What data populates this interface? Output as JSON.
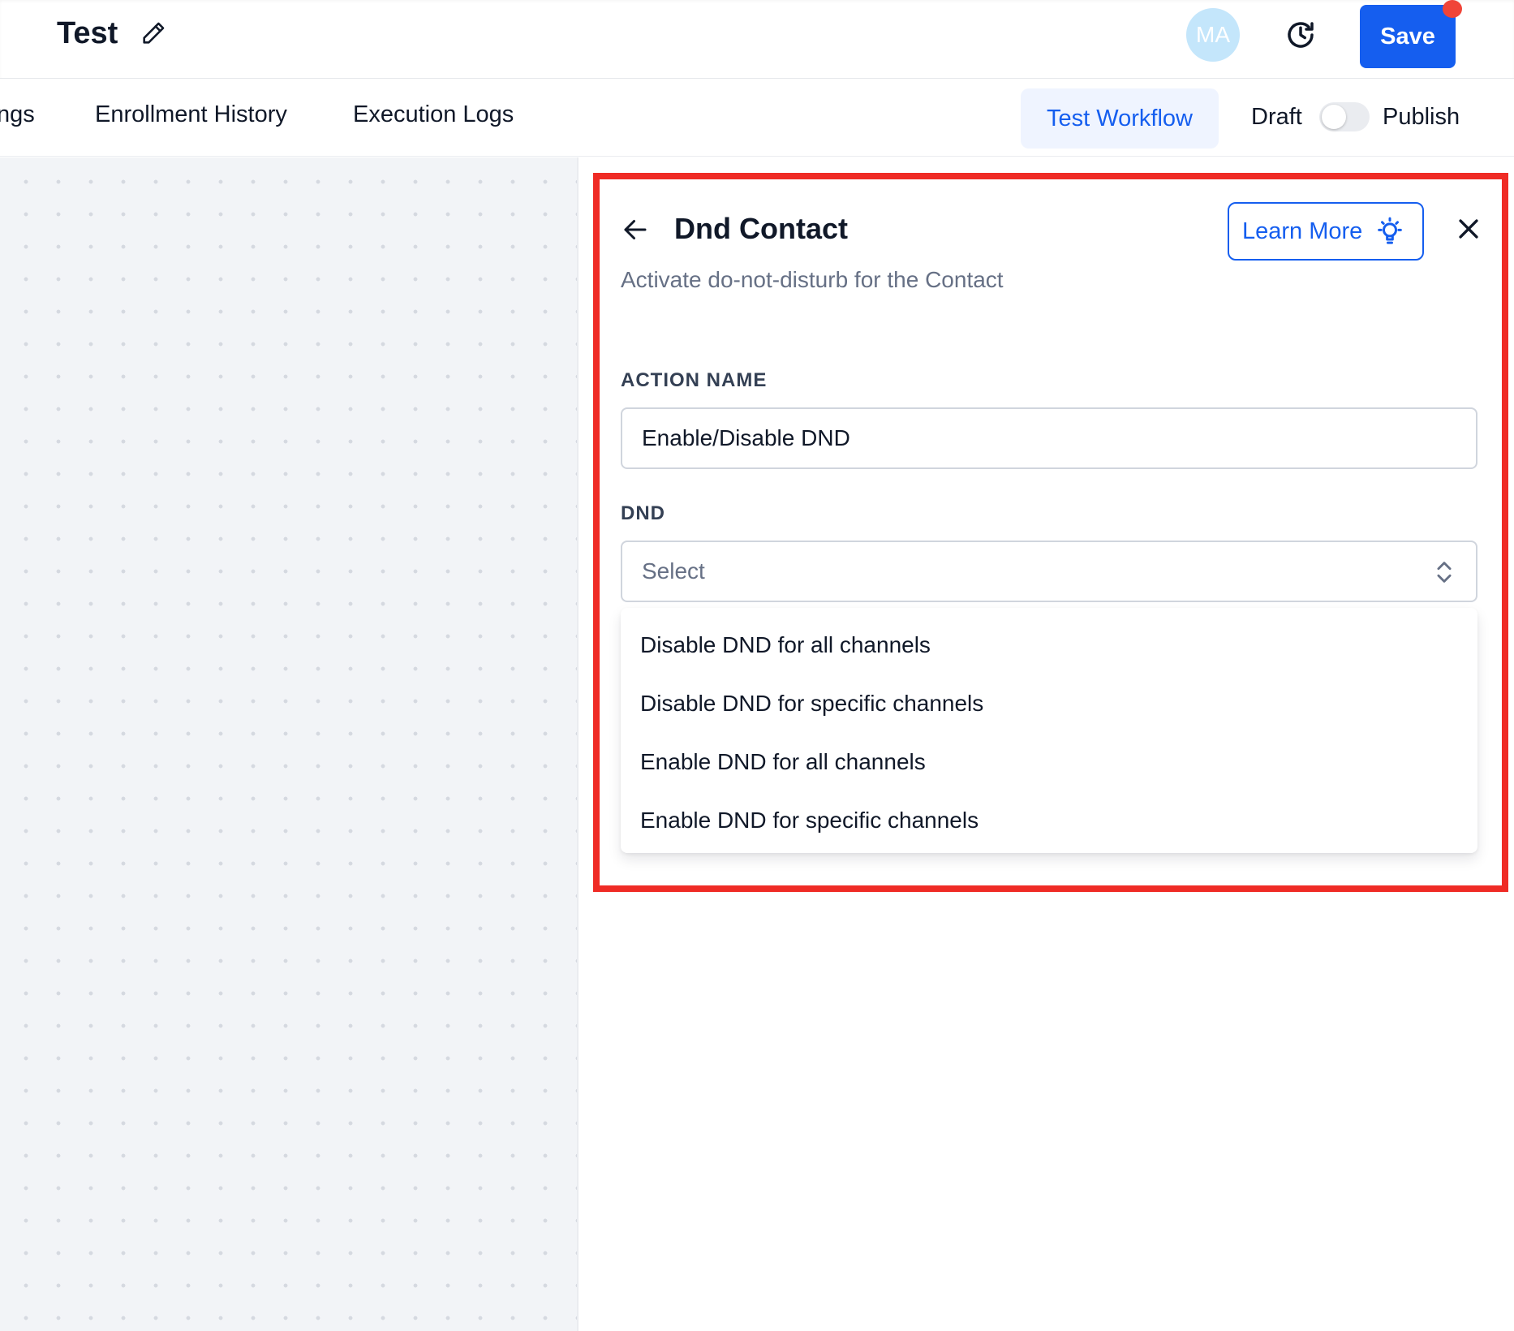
{
  "header": {
    "workflow_title": "Test",
    "avatar_initials": "MA",
    "save_label": "Save"
  },
  "tabs": {
    "items": [
      {
        "label": "ngs"
      },
      {
        "label": "Enrollment History"
      },
      {
        "label": "Execution Logs"
      }
    ],
    "test_workflow_label": "Test Workflow",
    "draft_label": "Draft",
    "publish_label": "Publish",
    "publish_toggle_on": false
  },
  "panel": {
    "title": "Dnd Contact",
    "learn_more_label": "Learn More",
    "description": "Activate do-not-disturb for the Contact",
    "action_name_label": "ACTION NAME",
    "action_name_value": "Enable/Disable DND",
    "dnd_label": "DND",
    "dnd_placeholder": "Select",
    "dnd_options": [
      "Disable DND for all channels",
      "Disable DND for specific channels",
      "Enable DND for all channels",
      "Enable DND for specific channels"
    ]
  },
  "colors": {
    "primary": "#155eef",
    "highlight_border": "#ef2b25",
    "notification_dot": "#f04438",
    "canvas_bg": "#f2f4f7"
  },
  "icons": [
    "pencil-icon",
    "history-clock-icon",
    "arrow-left-icon",
    "lightbulb-icon",
    "close-icon",
    "chevron-updown-icon"
  ]
}
